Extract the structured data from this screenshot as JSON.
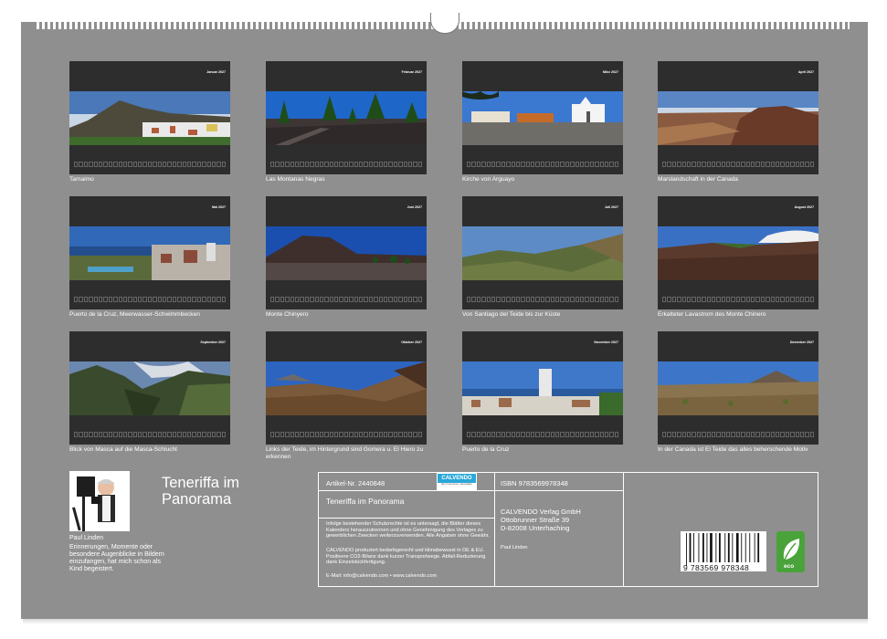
{
  "months": [
    {
      "label": "Januar 2027",
      "caption": "Tamaimo",
      "photo": "town"
    },
    {
      "label": "Februar 2027",
      "caption": "Las Montanas Negras",
      "photo": "forest"
    },
    {
      "label": "März 2027",
      "caption": "Kirche von Arguayo",
      "photo": "church"
    },
    {
      "label": "April 2027",
      "caption": "Marslandschaft in der Canada",
      "photo": "mars"
    },
    {
      "label": "Mai 2027",
      "caption": "Puerto de la Cruz, Meerwasser-Schwimmbecken",
      "photo": "coast"
    },
    {
      "label": "Juni 2027",
      "caption": "Monte Chinyero",
      "photo": "volcano"
    },
    {
      "label": "Juli 2027",
      "caption": "Von Santiago del Teide bis zur Küste",
      "photo": "valley"
    },
    {
      "label": "August 2027",
      "caption": "Erkalteter Lavastrom des Monte Chinero",
      "photo": "lava"
    },
    {
      "label": "September 2027",
      "caption": "Blick von Masca auf die Masca-Schlucht",
      "photo": "masca"
    },
    {
      "label": "Oktober 2027",
      "caption": "Links der Teide, im Hintergrund sind Gomera u. El Hiero zu erkennen",
      "photo": "teide"
    },
    {
      "label": "November 2027",
      "caption": "Puerto de la Cruz",
      "photo": "city"
    },
    {
      "label": "Dezember 2027",
      "caption": "In der Canada ist El Teide das alles beherschende Motiv",
      "photo": "canada"
    }
  ],
  "author": {
    "name": "Paul Linden",
    "text": "Erinnerungen, Momente oder besondere Augenblicke in Bildern einzufangen, hat mich schon als Kind begeistert."
  },
  "calendar_title": "Teneriffa im Panorama",
  "info": {
    "article_no": "Artikel-Nr. 2440848",
    "title": "Teneriffa im Panorama",
    "legal": "Infolge bestehender Schutzrechte ist es untersagt, die Blätter dieses Kalenders herauszutrennen und ohne Genehmigung des Verlages zu gewerblichen Zwecken weiterzuverwenden. Alle Angaben ohne Gewähr.",
    "eco_text": "CALVENDO produziert bedarfsgerecht und klimabewusst in DE & EU. Positivere CO2-Bilanz dank kurzer Transportwege. Abfall-Reduzierung dank Einzelstückfertigung.",
    "contact": "E-Mail: info@calvendo.com • www.calvendo.com",
    "isbn": "ISBN 9783569978348",
    "publisher_line1": "CALVENDO Verlag GmbH",
    "publisher_line2": "Ottobrunner Straße 39",
    "publisher_line3": "D-82008 Unterhaching",
    "author_small": "Paul Linden",
    "barcode_number": "9 783569 978348",
    "logo_text": "CALVENDO",
    "logo_sub": "BEST IN MONTHLY CALENDARS",
    "eco_label": "eco"
  }
}
